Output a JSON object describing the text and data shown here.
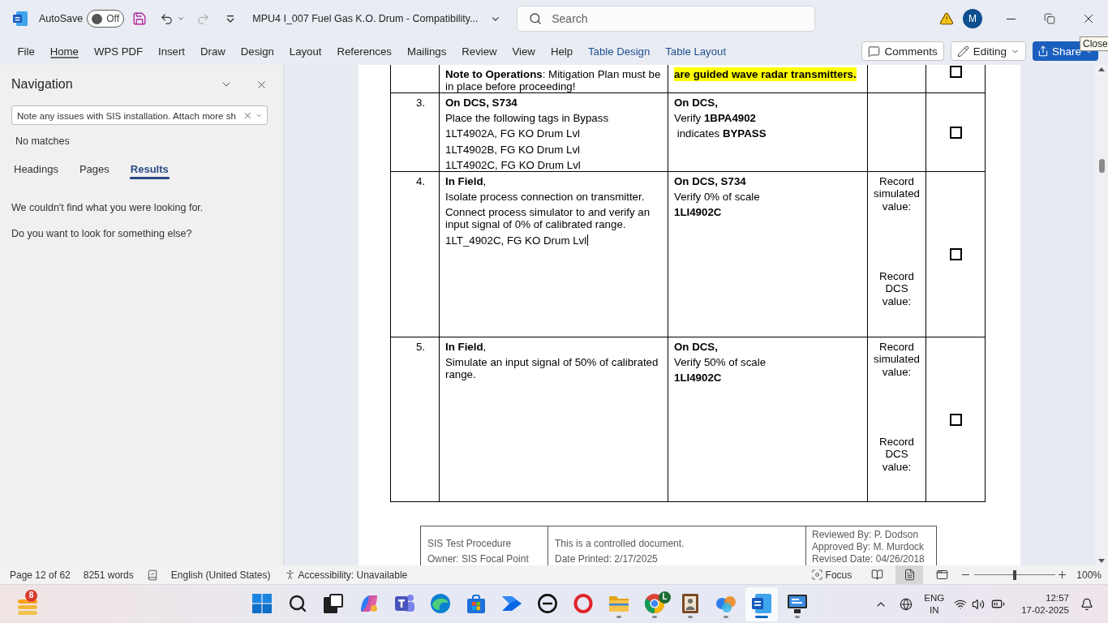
{
  "title_bar": {
    "autosave_label": "AutoSave",
    "autosave": {
      "label": "Off",
      "on": false
    },
    "document_title": "MPU4 I_007 Fuel Gas K.O. Drum - Compatibility...",
    "search": {
      "placeholder": "Search"
    },
    "avatar": "M",
    "tooltip": "Close"
  },
  "ribbon": {
    "tabs": [
      {
        "label": "File",
        "kind": "standard",
        "selected": false
      },
      {
        "label": "Home",
        "kind": "standard",
        "selected": true
      },
      {
        "label": "WPS PDF",
        "kind": "standard",
        "selected": false
      },
      {
        "label": "Insert",
        "kind": "standard",
        "selected": false
      },
      {
        "label": "Draw",
        "kind": "standard",
        "selected": false
      },
      {
        "label": "Design",
        "kind": "standard",
        "selected": false
      },
      {
        "label": "Layout",
        "kind": "standard",
        "selected": false
      },
      {
        "label": "References",
        "kind": "standard",
        "selected": false
      },
      {
        "label": "Mailings",
        "kind": "standard",
        "selected": false
      },
      {
        "label": "Review",
        "kind": "standard",
        "selected": false
      },
      {
        "label": "View",
        "kind": "standard",
        "selected": false
      },
      {
        "label": "Help",
        "kind": "standard",
        "selected": false
      },
      {
        "label": "Table Design",
        "kind": "contextual",
        "selected": false
      },
      {
        "label": "Table Layout",
        "kind": "contextual",
        "selected": false
      }
    ],
    "comments": "Comments",
    "editing": "Editing",
    "share": "Share"
  },
  "navigation": {
    "title": "Navigation",
    "search": {
      "value": "Note any issues with SIS installation. Attach more sh"
    },
    "status": "No matches",
    "tabs": [
      {
        "label": "Headings",
        "selected": false
      },
      {
        "label": "Pages",
        "selected": false
      },
      {
        "label": "Results",
        "selected": true
      }
    ],
    "messages": [
      "We couldn't find what you were looking for.",
      "Do you want to look for something else?"
    ]
  },
  "document": {
    "table": {
      "rows": [
        {
          "step": [
            {
              "kind": "body",
              "text": "**Note to Operations**: Mitigation Plan must be in place before proceeding!"
            }
          ],
          "dcs": [
            {
              "kind": "highlight",
              "text": "are guided wave radar transmitters."
            }
          ],
          "checked": false
        },
        {
          "number": "3.",
          "step": [
            {
              "kind": "heading",
              "text": "On DCS, S734"
            },
            {
              "kind": "body",
              "text": "Place the following tags in Bypass"
            },
            {
              "kind": "body",
              "text": "1LT4902A, FG KO Drum Lvl"
            },
            {
              "kind": "body",
              "text": "1LT4902B, FG KO Drum Lvl"
            },
            {
              "kind": "body",
              "text": "1LT4902C, FG KO Drum Lvl"
            }
          ],
          "dcs": [
            {
              "kind": "heading",
              "text": "On DCS,"
            },
            {
              "kind": "body",
              "text": "Verify **1BPA4902**"
            },
            {
              "kind": "body",
              "text": " indicates **BYPASS**"
            }
          ],
          "checked": false
        },
        {
          "number": "4.",
          "step": [
            {
              "kind": "body",
              "text": "**In Field**,"
            },
            {
              "kind": "body",
              "text": "Isolate process connection on transmitter."
            },
            {
              "kind": "body",
              "text": "Connect process simulator to and verify an input signal of 0% of calibrated range."
            },
            {
              "kind": "body",
              "text": "1LT_4902C, FG KO Drum Lvl",
              "cursor": true
            }
          ],
          "dcs": [
            {
              "kind": "heading",
              "text": "On DCS, S734"
            },
            {
              "kind": "body",
              "text": "Verify 0% of scale"
            },
            {
              "kind": "heading",
              "text": "1LI4902C"
            }
          ],
          "record": [
            "Record simulated value:",
            "Record DCS value:"
          ],
          "checked": false
        },
        {
          "number": "5.",
          "step": [
            {
              "kind": "body",
              "text": "**In Field**,"
            },
            {
              "kind": "body",
              "text": "Simulate an input signal of 50% of calibrated range."
            }
          ],
          "dcs": [
            {
              "kind": "heading",
              "text": "On DCS,"
            },
            {
              "kind": "body",
              "text": "Verify 50% of scale"
            },
            {
              "kind": "heading",
              "text": "1LI4902C"
            }
          ],
          "record": [
            "Record simulated value:",
            "Record DCS value:"
          ],
          "checked": false
        }
      ]
    },
    "footer": {
      "cells": [
        [
          "SIS Test Procedure",
          "Owner: SIS Focal Point"
        ],
        [
          "This is a controlled document.",
          "Date Printed: 2/17/2025"
        ],
        [
          "Reviewed By: P. Dodson",
          "Approved By: M. Murdock",
          "Revised Date: 04/26/2018"
        ]
      ]
    }
  },
  "status_bar": {
    "page": "Page 12 of 62",
    "words": "8251 words",
    "language": "English (United States)",
    "accessibility": "Accessibility: Unavailable",
    "focus": "Focus",
    "views": [
      {
        "kind": "read",
        "selected": false
      },
      {
        "kind": "print",
        "selected": true
      },
      {
        "kind": "web",
        "selected": false
      }
    ],
    "zoom": {
      "level": 0.5,
      "reading": "100%"
    }
  },
  "taskbar": {
    "widgets": {
      "badge": "8"
    },
    "apps": [
      {
        "kind": "grid",
        "running": false,
        "selected": false
      },
      {
        "kind": "search",
        "running": false,
        "selected": false
      },
      {
        "kind": "task_view",
        "running": false,
        "selected": false
      },
      {
        "kind": "swirl",
        "running": false,
        "selected": false
      },
      {
        "kind": "people",
        "running": false,
        "selected": false
      },
      {
        "kind": "wave",
        "running": false,
        "selected": false
      },
      {
        "kind": "bag",
        "running": false,
        "selected": false
      },
      {
        "kind": "arrow",
        "running": false,
        "selected": false
      },
      {
        "kind": "ring",
        "running": false,
        "selected": false
      },
      {
        "kind": "oval",
        "running": false,
        "selected": false
      },
      {
        "kind": "folder",
        "running": true,
        "selected": false
      },
      {
        "kind": "segmented",
        "running": true,
        "selected": false,
        "badge": "L"
      },
      {
        "kind": "frame",
        "running": true,
        "selected": false
      },
      {
        "kind": "cluster",
        "running": true,
        "selected": false
      },
      {
        "kind": "document",
        "running": true,
        "selected": true
      },
      {
        "kind": "screen",
        "running": true,
        "selected": false
      }
    ],
    "tray": {
      "language": "ENG",
      "region": "IN",
      "time": "12:57",
      "date": "17-02-2025"
    }
  }
}
